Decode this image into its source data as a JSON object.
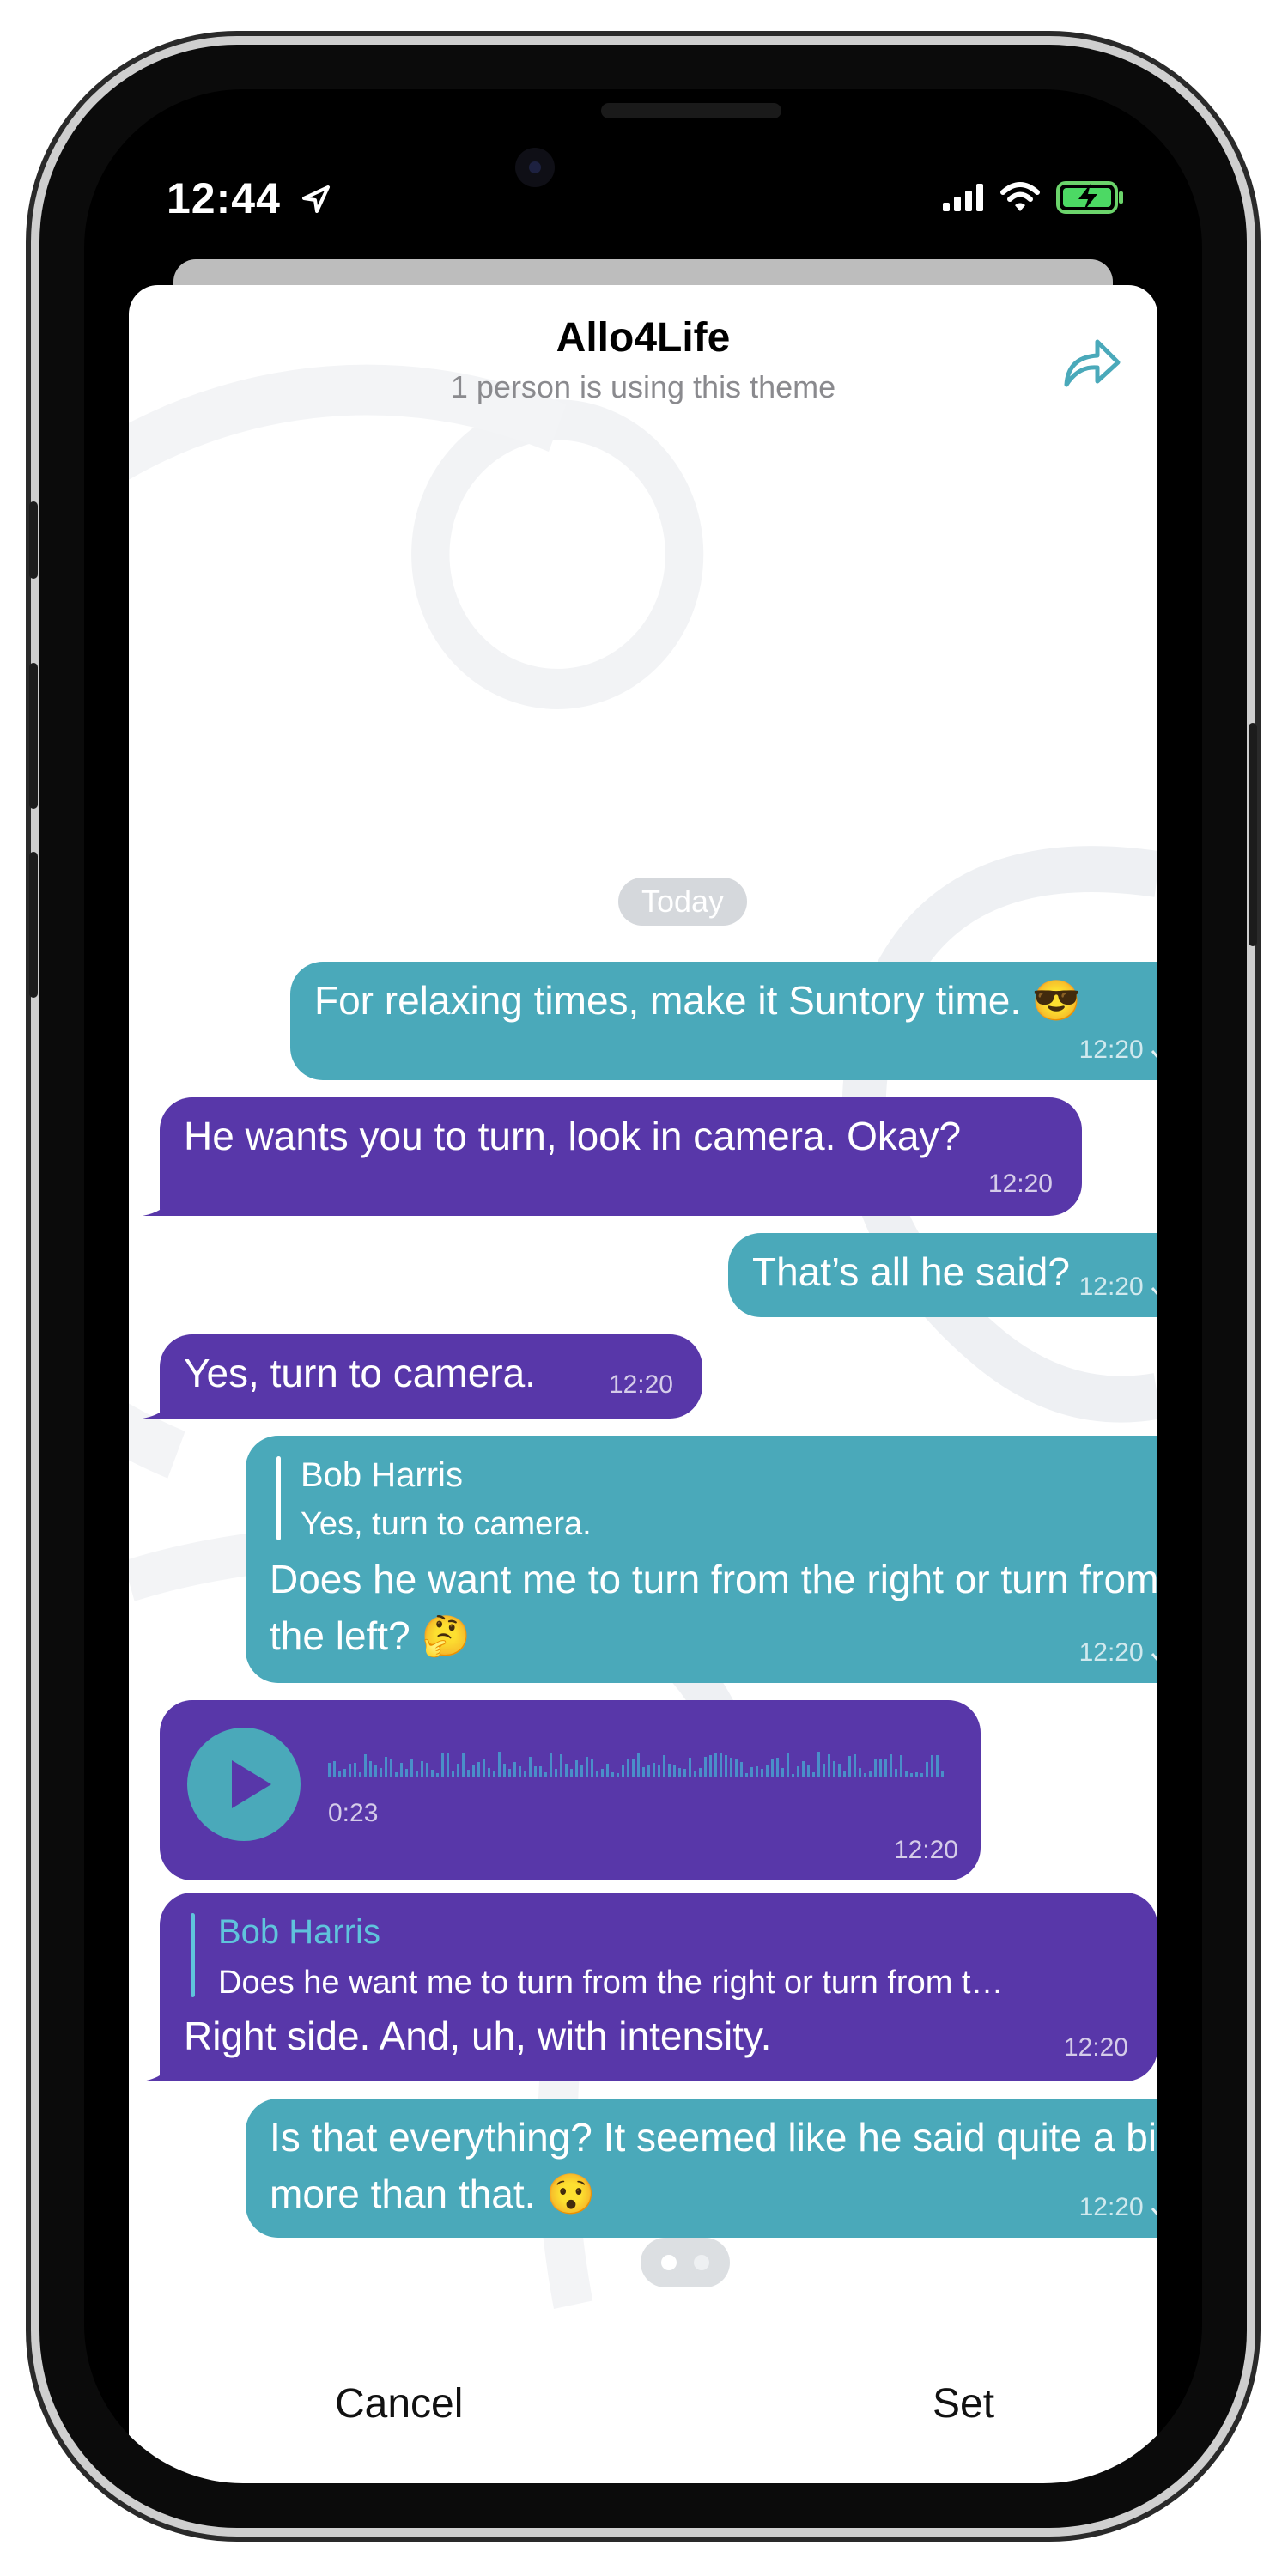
{
  "status_bar": {
    "time": "12:44",
    "icons": [
      "location-arrow-icon",
      "signal-icon",
      "wifi-icon",
      "battery-charging-icon"
    ]
  },
  "header": {
    "title": "Allo4Life",
    "subtitle": "1 person is using this theme",
    "share_icon": "share-arrow-icon"
  },
  "date_badge": "Today",
  "messages": [
    {
      "direction": "outgoing",
      "text": "For relaxing times, make it Suntory time. 😎",
      "time": "12:20",
      "status": "read"
    },
    {
      "direction": "incoming",
      "text": "He wants you to turn, look in camera. Okay?",
      "time": "12:20"
    },
    {
      "direction": "outgoing",
      "text": "That’s all he said?",
      "time": "12:20",
      "status": "read"
    },
    {
      "direction": "incoming",
      "text": "Yes, turn to camera.",
      "time": "12:20"
    },
    {
      "direction": "outgoing",
      "reply_name": "Bob Harris",
      "reply_text": "Yes, turn to camera.",
      "text": "Does he want me to turn from the right or turn from the left? 🤔",
      "time": "12:20",
      "status": "read"
    },
    {
      "direction": "incoming",
      "type": "voice",
      "duration": "0:23",
      "time": "12:20"
    },
    {
      "direction": "incoming",
      "reply_name": "Bob Harris",
      "reply_text": "Does he want me to turn from the right or turn from t…",
      "text": "Right side. And, uh, with intensity.",
      "time": "12:20"
    },
    {
      "direction": "outgoing",
      "text": "Is that everything? It seemed like he said quite a bit more than that. 😯",
      "time": "12:20",
      "status": "read"
    }
  ],
  "page_indicator": {
    "pages": 2,
    "current": 1
  },
  "actions": {
    "cancel": "Cancel",
    "set": "Set"
  },
  "colors": {
    "outgoing": "#4aa9ba",
    "incoming": "#5837a9",
    "reply_name_in": "#5fc4dc",
    "accent": "#4aa9ba"
  }
}
